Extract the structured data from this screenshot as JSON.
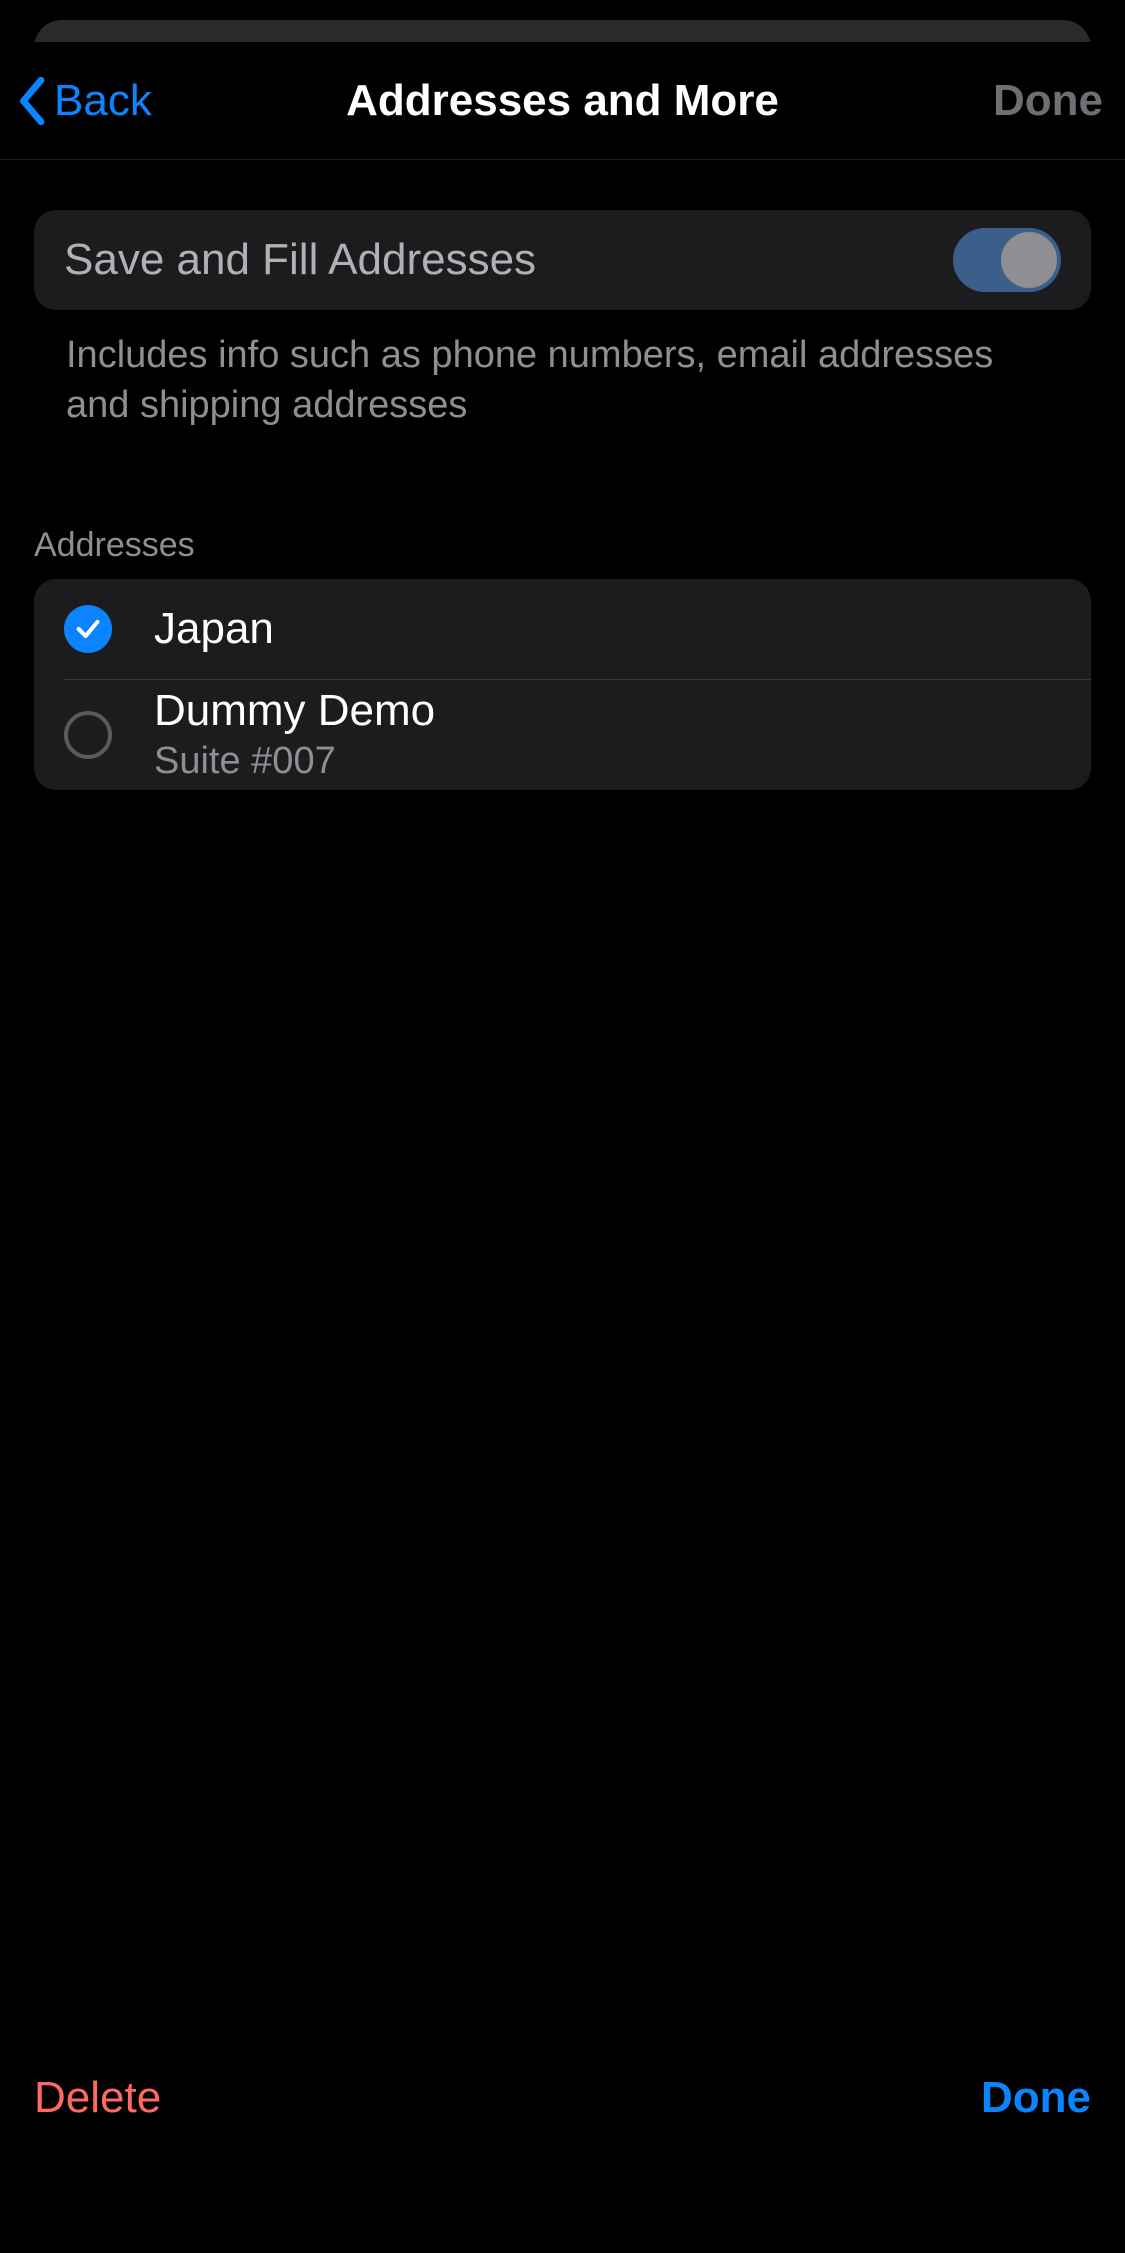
{
  "nav": {
    "back_label": "Back",
    "title": "Addresses and More",
    "done_label": "Done"
  },
  "toggle": {
    "label": "Save and Fill Addresses",
    "on": true
  },
  "toggle_footer": "Includes info such as phone numbers, email addresses and shipping addresses",
  "section_header": "Addresses",
  "addresses": [
    {
      "title": "Japan",
      "subtitle": "",
      "selected": true
    },
    {
      "title": "Dummy Demo",
      "subtitle": "Suite #007",
      "selected": false
    }
  ],
  "bottom": {
    "delete_label": "Delete",
    "done_label": "Done"
  }
}
